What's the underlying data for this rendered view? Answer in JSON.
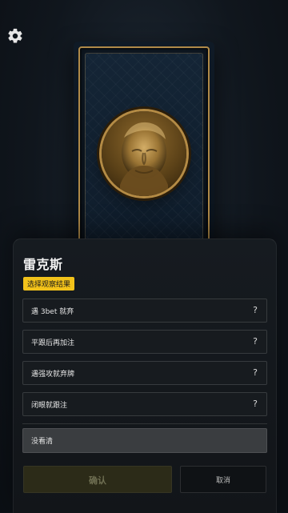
{
  "icons": {
    "settings": "gear-icon",
    "help": "question-icon"
  },
  "colors": {
    "accent_tag": "#f2c21a",
    "card_frame": "#b08a48",
    "panel_bg": "#161b20"
  },
  "player": {
    "name": "雷克斯"
  },
  "panel": {
    "tag_label": "选择观察结果",
    "options": [
      {
        "label": "遇 3bet 就弃",
        "help": "?"
      },
      {
        "label": "平跟后再加注",
        "help": "?"
      },
      {
        "label": "遇强攻就弃牌",
        "help": "?"
      },
      {
        "label": "闭眼就跟注",
        "help": "?"
      }
    ],
    "not_seen_label": "没看清",
    "confirm_label": "确认",
    "cancel_label": "取消"
  }
}
